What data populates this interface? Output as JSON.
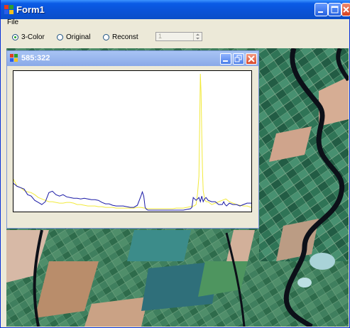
{
  "window": {
    "title": "Form1"
  },
  "menu": {
    "items": [
      {
        "label": "File"
      }
    ]
  },
  "options": {
    "radios": [
      {
        "label": "3-Color",
        "selected": true
      },
      {
        "label": "Original",
        "selected": false
      },
      {
        "label": "Reconst",
        "selected": false
      }
    ],
    "spinner": {
      "value": "1"
    }
  },
  "child_window": {
    "title": "585:322"
  },
  "chart_data": {
    "type": "line",
    "title": "",
    "xlabel": "",
    "ylabel": "",
    "xlim": [
      0,
      336
    ],
    "ylim": [
      0,
      200
    ],
    "grid": false,
    "series": [
      {
        "color": "#1a1aa6",
        "x": [
          0,
          5,
          10,
          15,
          20,
          25,
          30,
          35,
          40,
          45,
          50,
          55,
          60,
          65,
          70,
          75,
          80,
          85,
          90,
          95,
          100,
          105,
          110,
          115,
          120,
          125,
          130,
          135,
          140,
          145,
          150,
          155,
          160,
          165,
          170,
          175,
          180,
          182,
          184,
          186,
          188,
          190,
          195,
          200,
          205,
          210,
          215,
          220,
          225,
          230,
          235,
          240,
          245,
          250,
          252,
          254,
          256,
          258,
          260,
          262,
          264,
          266,
          268,
          270,
          272,
          275,
          280,
          285,
          290,
          295,
          297,
          299,
          301,
          303,
          305,
          310,
          315,
          320,
          325,
          330,
          336
        ],
        "y": [
          40,
          36,
          34,
          32,
          24,
          22,
          16,
          13,
          10,
          14,
          27,
          29,
          24,
          22,
          24,
          21,
          20,
          19,
          19,
          18,
          19,
          18,
          17,
          17,
          16,
          13,
          11,
          11,
          9,
          8,
          8,
          8,
          7,
          6,
          6,
          9,
          22,
          28,
          22,
          6,
          3,
          2,
          2,
          2,
          2,
          2,
          2,
          2,
          2,
          2,
          2,
          2,
          3,
          4,
          6,
          20,
          18,
          16,
          18,
          20,
          14,
          22,
          14,
          18,
          20,
          16,
          14,
          14,
          10,
          10,
          14,
          10,
          8,
          10,
          12,
          10,
          10,
          8,
          10,
          12,
          12
        ]
      },
      {
        "color": "#f2ea3c",
        "x": [
          0,
          5,
          10,
          15,
          20,
          25,
          30,
          35,
          40,
          45,
          50,
          55,
          60,
          65,
          70,
          75,
          80,
          85,
          90,
          95,
          100,
          105,
          110,
          115,
          120,
          125,
          130,
          135,
          140,
          145,
          150,
          155,
          160,
          165,
          170,
          175,
          180,
          185,
          190,
          195,
          200,
          205,
          210,
          215,
          220,
          225,
          230,
          235,
          240,
          245,
          250,
          255,
          258,
          260,
          262,
          263,
          264,
          265,
          266,
          267,
          268,
          270,
          272,
          275,
          280,
          285,
          290,
          295,
          300,
          305,
          310,
          315,
          320,
          325,
          330,
          336
        ],
        "y": [
          46,
          36,
          34,
          30,
          28,
          27,
          24,
          20,
          18,
          16,
          14,
          14,
          13,
          12,
          12,
          13,
          13,
          12,
          10,
          10,
          9,
          8,
          8,
          8,
          7,
          7,
          6,
          6,
          6,
          5,
          5,
          5,
          5,
          5,
          5,
          6,
          6,
          5,
          4,
          4,
          4,
          4,
          4,
          4,
          4,
          4,
          5,
          5,
          5,
          6,
          7,
          8,
          10,
          25,
          50,
          120,
          196,
          170,
          110,
          60,
          30,
          18,
          14,
          14,
          10,
          12,
          14,
          16,
          18,
          14,
          12,
          10,
          9,
          8,
          8,
          6
        ]
      }
    ]
  },
  "colors": {
    "titlebar": "#0a53d8",
    "child_titlebar": "#8aa9e8",
    "blue_series": "#1a1aa6",
    "yellow_series": "#f2ea3c"
  }
}
